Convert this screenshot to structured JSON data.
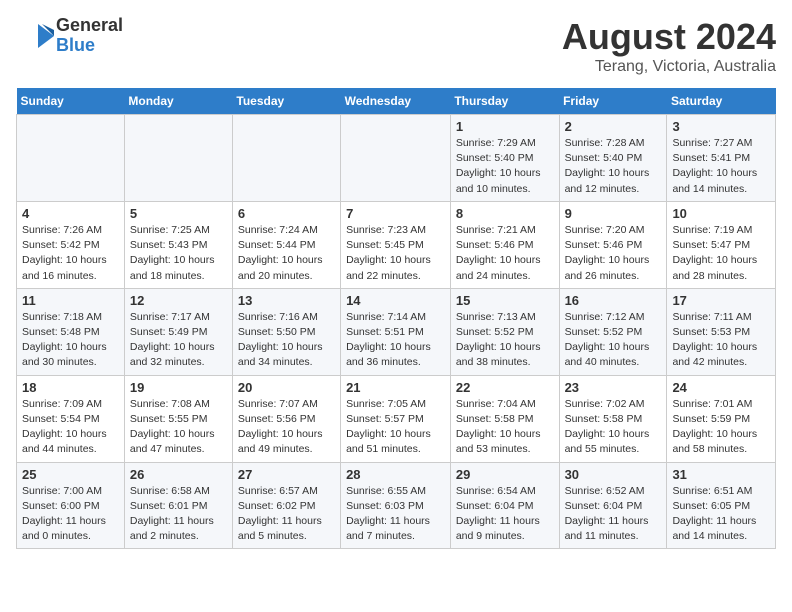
{
  "logo": {
    "general": "General",
    "blue": "Blue"
  },
  "title": "August 2024",
  "subtitle": "Terang, Victoria, Australia",
  "days_of_week": [
    "Sunday",
    "Monday",
    "Tuesday",
    "Wednesday",
    "Thursday",
    "Friday",
    "Saturday"
  ],
  "weeks": [
    [
      {
        "day": "",
        "info": ""
      },
      {
        "day": "",
        "info": ""
      },
      {
        "day": "",
        "info": ""
      },
      {
        "day": "",
        "info": ""
      },
      {
        "day": "1",
        "info": "Sunrise: 7:29 AM\nSunset: 5:40 PM\nDaylight: 10 hours\nand 10 minutes."
      },
      {
        "day": "2",
        "info": "Sunrise: 7:28 AM\nSunset: 5:40 PM\nDaylight: 10 hours\nand 12 minutes."
      },
      {
        "day": "3",
        "info": "Sunrise: 7:27 AM\nSunset: 5:41 PM\nDaylight: 10 hours\nand 14 minutes."
      }
    ],
    [
      {
        "day": "4",
        "info": "Sunrise: 7:26 AM\nSunset: 5:42 PM\nDaylight: 10 hours\nand 16 minutes."
      },
      {
        "day": "5",
        "info": "Sunrise: 7:25 AM\nSunset: 5:43 PM\nDaylight: 10 hours\nand 18 minutes."
      },
      {
        "day": "6",
        "info": "Sunrise: 7:24 AM\nSunset: 5:44 PM\nDaylight: 10 hours\nand 20 minutes."
      },
      {
        "day": "7",
        "info": "Sunrise: 7:23 AM\nSunset: 5:45 PM\nDaylight: 10 hours\nand 22 minutes."
      },
      {
        "day": "8",
        "info": "Sunrise: 7:21 AM\nSunset: 5:46 PM\nDaylight: 10 hours\nand 24 minutes."
      },
      {
        "day": "9",
        "info": "Sunrise: 7:20 AM\nSunset: 5:46 PM\nDaylight: 10 hours\nand 26 minutes."
      },
      {
        "day": "10",
        "info": "Sunrise: 7:19 AM\nSunset: 5:47 PM\nDaylight: 10 hours\nand 28 minutes."
      }
    ],
    [
      {
        "day": "11",
        "info": "Sunrise: 7:18 AM\nSunset: 5:48 PM\nDaylight: 10 hours\nand 30 minutes."
      },
      {
        "day": "12",
        "info": "Sunrise: 7:17 AM\nSunset: 5:49 PM\nDaylight: 10 hours\nand 32 minutes."
      },
      {
        "day": "13",
        "info": "Sunrise: 7:16 AM\nSunset: 5:50 PM\nDaylight: 10 hours\nand 34 minutes."
      },
      {
        "day": "14",
        "info": "Sunrise: 7:14 AM\nSunset: 5:51 PM\nDaylight: 10 hours\nand 36 minutes."
      },
      {
        "day": "15",
        "info": "Sunrise: 7:13 AM\nSunset: 5:52 PM\nDaylight: 10 hours\nand 38 minutes."
      },
      {
        "day": "16",
        "info": "Sunrise: 7:12 AM\nSunset: 5:52 PM\nDaylight: 10 hours\nand 40 minutes."
      },
      {
        "day": "17",
        "info": "Sunrise: 7:11 AM\nSunset: 5:53 PM\nDaylight: 10 hours\nand 42 minutes."
      }
    ],
    [
      {
        "day": "18",
        "info": "Sunrise: 7:09 AM\nSunset: 5:54 PM\nDaylight: 10 hours\nand 44 minutes."
      },
      {
        "day": "19",
        "info": "Sunrise: 7:08 AM\nSunset: 5:55 PM\nDaylight: 10 hours\nand 47 minutes."
      },
      {
        "day": "20",
        "info": "Sunrise: 7:07 AM\nSunset: 5:56 PM\nDaylight: 10 hours\nand 49 minutes."
      },
      {
        "day": "21",
        "info": "Sunrise: 7:05 AM\nSunset: 5:57 PM\nDaylight: 10 hours\nand 51 minutes."
      },
      {
        "day": "22",
        "info": "Sunrise: 7:04 AM\nSunset: 5:58 PM\nDaylight: 10 hours\nand 53 minutes."
      },
      {
        "day": "23",
        "info": "Sunrise: 7:02 AM\nSunset: 5:58 PM\nDaylight: 10 hours\nand 55 minutes."
      },
      {
        "day": "24",
        "info": "Sunrise: 7:01 AM\nSunset: 5:59 PM\nDaylight: 10 hours\nand 58 minutes."
      }
    ],
    [
      {
        "day": "25",
        "info": "Sunrise: 7:00 AM\nSunset: 6:00 PM\nDaylight: 11 hours\nand 0 minutes."
      },
      {
        "day": "26",
        "info": "Sunrise: 6:58 AM\nSunset: 6:01 PM\nDaylight: 11 hours\nand 2 minutes."
      },
      {
        "day": "27",
        "info": "Sunrise: 6:57 AM\nSunset: 6:02 PM\nDaylight: 11 hours\nand 5 minutes."
      },
      {
        "day": "28",
        "info": "Sunrise: 6:55 AM\nSunset: 6:03 PM\nDaylight: 11 hours\nand 7 minutes."
      },
      {
        "day": "29",
        "info": "Sunrise: 6:54 AM\nSunset: 6:04 PM\nDaylight: 11 hours\nand 9 minutes."
      },
      {
        "day": "30",
        "info": "Sunrise: 6:52 AM\nSunset: 6:04 PM\nDaylight: 11 hours\nand 11 minutes."
      },
      {
        "day": "31",
        "info": "Sunrise: 6:51 AM\nSunset: 6:05 PM\nDaylight: 11 hours\nand 14 minutes."
      }
    ]
  ]
}
